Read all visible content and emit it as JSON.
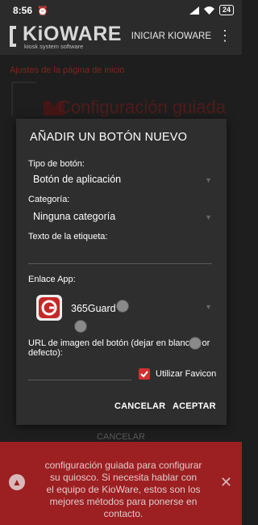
{
  "statusbar": {
    "time": "8:56",
    "battery": "24"
  },
  "appbar": {
    "brand_name": "KiOWARE",
    "brand_tagline": "kiosk system software",
    "action_label": "INICIAR KIOWARE"
  },
  "background": {
    "section_title": "Ajustes de la página de inicio",
    "guide_title": "Configuración guiada",
    "cancel_label": "CANCELAR"
  },
  "dialog": {
    "title": "AÑADIR UN BOTÓN NUEVO",
    "button_type_label": "Tipo de botón:",
    "button_type_value": "Botón de aplicación",
    "category_label": "Categoría:",
    "category_value": "Ninguna categoría",
    "label_text_label": "Texto de la etiqueta:",
    "label_text_value": "",
    "app_link_label": "Enlace App:",
    "app_name": "365Guard",
    "image_url_label_1": "URL de imagen del botón (dejar en blanco por",
    "image_url_label_2": "defecto):",
    "image_url_value": "",
    "favicon_label": "Utilizar Favicon",
    "favicon_checked": true,
    "cancel_label": "CANCELAR",
    "accept_label": "ACEPTAR"
  },
  "banner": {
    "lines": [
      "configuración guiada para configurar",
      "su quiosco. Si necesita hablar con",
      "el equipo de KioWare, estos son los",
      "mejores métodos para ponerse en",
      "contacto."
    ]
  },
  "colors": {
    "accent": "#d32f2f",
    "banner": "#9c1f22",
    "dialog": "#2e2e2e"
  }
}
